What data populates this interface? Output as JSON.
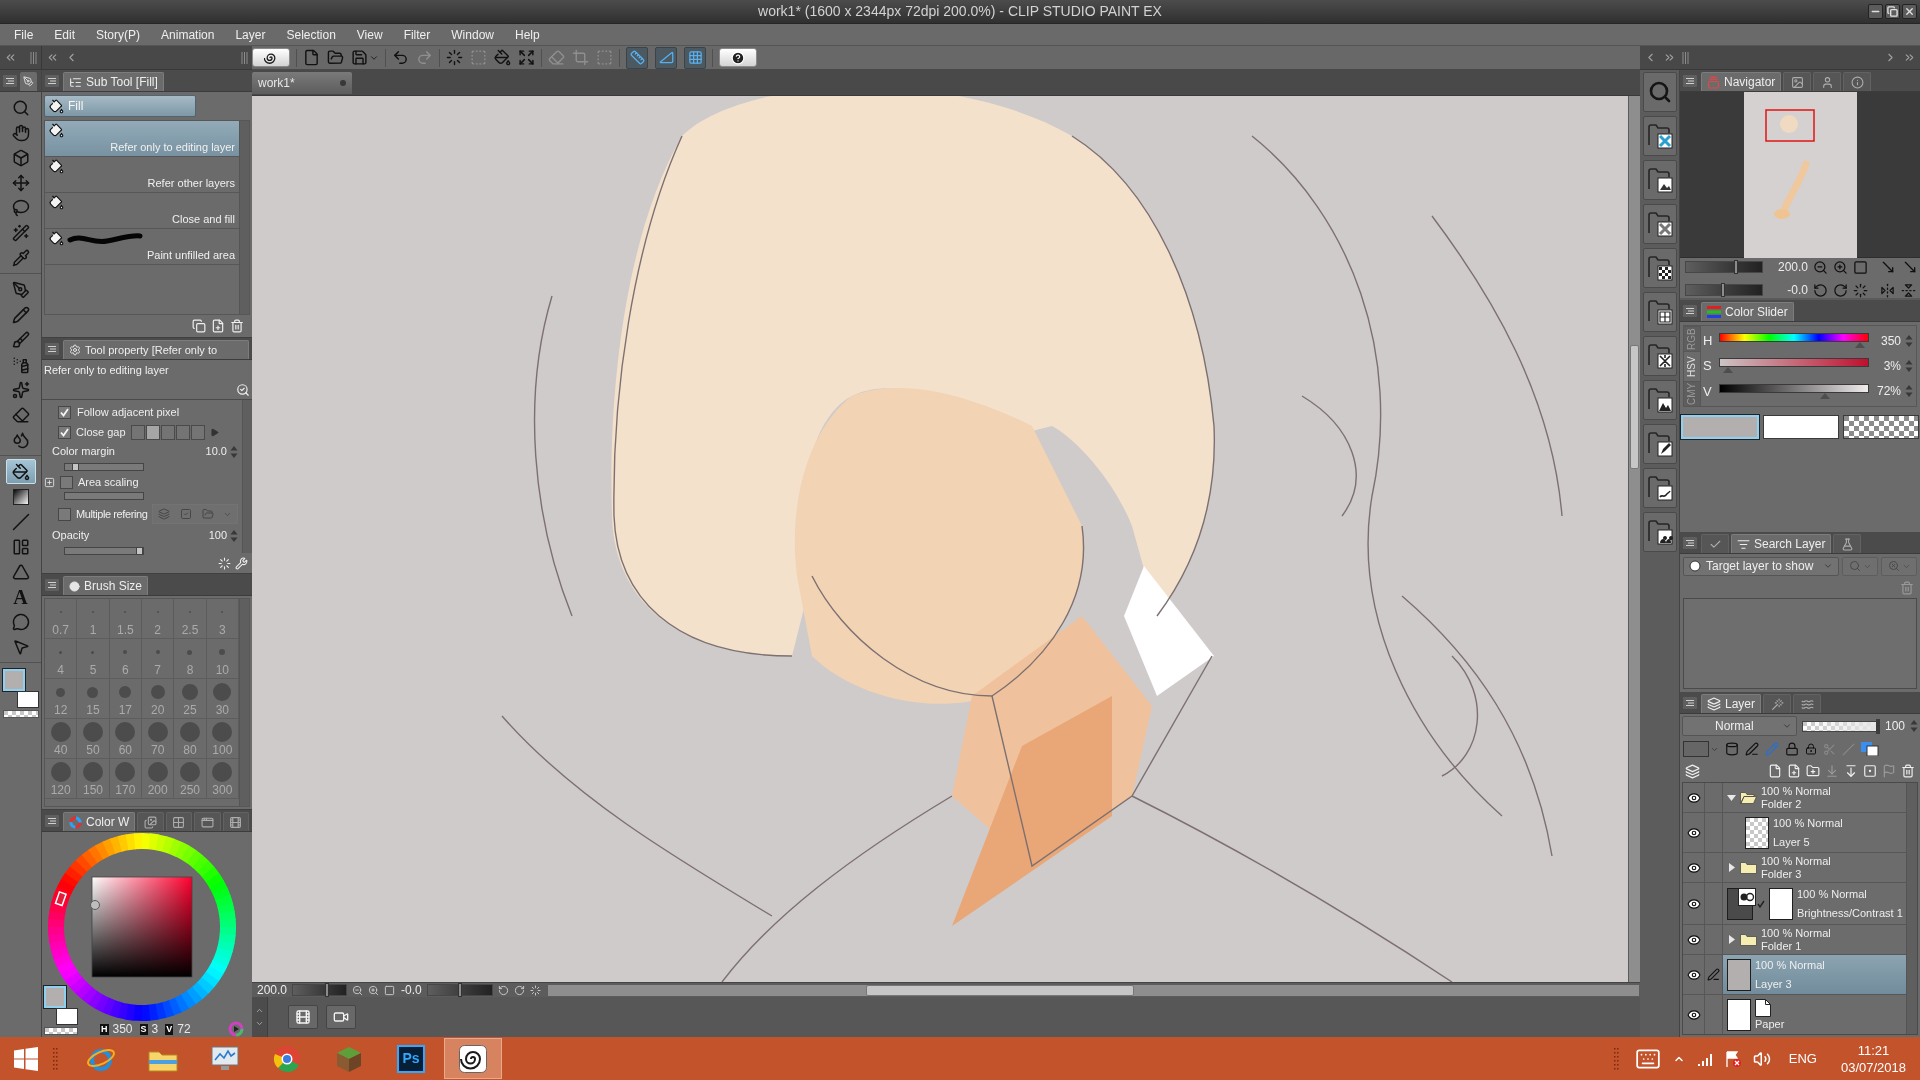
{
  "window": {
    "title": "work1* (1600 x 2344px 72dpi 200.0%) - CLIP STUDIO PAINT EX"
  },
  "menu": [
    "File",
    "Edit",
    "Story(P)",
    "Animation",
    "Layer",
    "Selection",
    "View",
    "Filter",
    "Window",
    "Help"
  ],
  "toolbar": {
    "groups": [
      {
        "buttons": [
          {
            "kind": "logo",
            "disabled": false
          }
        ]
      },
      {
        "buttons": [
          {
            "kind": "new",
            "disabled": false
          },
          {
            "kind": "open",
            "disabled": false
          },
          {
            "kind": "save",
            "disabled": false
          }
        ]
      },
      {
        "buttons": [
          {
            "kind": "undo",
            "disabled": false
          },
          {
            "kind": "redo",
            "disabled": true
          }
        ]
      },
      {
        "buttons": [
          {
            "kind": "dots",
            "disabled": false
          },
          {
            "kind": "box",
            "disabled": true
          },
          {
            "kind": "fill",
            "disabled": false
          },
          {
            "kind": "transform",
            "disabled": false
          }
        ]
      },
      {
        "buttons": [
          {
            "kind": "clear",
            "disabled": true
          },
          {
            "kind": "trim",
            "disabled": true
          },
          {
            "kind": "frame",
            "disabled": true
          }
        ]
      },
      {
        "buttons": [
          {
            "kind": "snap_ruler",
            "on": true
          },
          {
            "kind": "snap_special",
            "on": true
          },
          {
            "kind": "snap_grid",
            "on": true
          }
        ]
      },
      {
        "buttons": [
          {
            "kind": "help",
            "disabled": false
          }
        ]
      }
    ]
  },
  "tool_palette": {
    "groups": [
      {
        "tools": [
          {
            "kind": "zoom",
            "selected": false
          },
          {
            "kind": "hand",
            "selected": false
          },
          {
            "kind": "object",
            "selected": false
          },
          {
            "kind": "move",
            "selected": false
          },
          {
            "kind": "lasso",
            "selected": false
          },
          {
            "kind": "wand",
            "selected": false
          },
          {
            "kind": "eyedropper",
            "selected": false
          }
        ]
      },
      {
        "tools": [
          {
            "kind": "pen",
            "selected": false
          },
          {
            "kind": "pencil",
            "selected": false
          },
          {
            "kind": "brush",
            "selected": false
          },
          {
            "kind": "airbrush",
            "selected": false
          },
          {
            "kind": "decoration",
            "selected": false
          },
          {
            "kind": "eraser",
            "selected": false
          },
          {
            "kind": "blend",
            "selected": false
          }
        ]
      },
      {
        "tools": [
          {
            "kind": "fill",
            "selected": true
          },
          {
            "kind": "gradient",
            "selected": false
          },
          {
            "kind": "line",
            "selected": false
          },
          {
            "kind": "frame",
            "selected": false
          },
          {
            "kind": "ruler",
            "selected": false
          },
          {
            "kind": "text",
            "glyph": "A",
            "selected": false
          },
          {
            "kind": "balloon",
            "selected": false
          },
          {
            "kind": "correct",
            "selected": false
          }
        ]
      }
    ]
  },
  "drawing_colors": [
    {
      "kind": "main",
      "color": "#b3afae",
      "selected": true
    },
    {
      "kind": "sub",
      "color": "#ffffff",
      "selected": false
    },
    {
      "kind": "transparent",
      "selected": false
    }
  ],
  "sub_tool": {
    "title": "Sub Tool [Fill]",
    "group": "Fill",
    "items": [
      {
        "kind": "icon",
        "label": "Refer only to editing layer",
        "selected": true
      },
      {
        "kind": "icon",
        "label": "Refer other layers",
        "selected": false
      },
      {
        "kind": "icon",
        "label": "Close and fill",
        "selected": false
      },
      {
        "kind": "stroke",
        "label": "Paint unfilled area",
        "selected": false
      }
    ]
  },
  "tool_property": {
    "title": "Tool property [Refer only to",
    "preview": "Refer only to editing layer",
    "properties": [
      {
        "kind": "check",
        "label": "Follow adjacent pixel",
        "checked": true
      },
      {
        "kind": "gap",
        "label": "Close gap",
        "checked": true,
        "gap_sizes": [
          {
            "selected": false
          },
          {
            "selected": true
          },
          {
            "selected": false
          },
          {
            "selected": false
          },
          {
            "selected": false
          }
        ]
      },
      {
        "kind": "slider",
        "label": "Color margin",
        "value": "10.0",
        "level": 0.1
      },
      {
        "kind": "check_slider",
        "label": "Area scaling",
        "checked": false
      },
      {
        "kind": "check_icons",
        "label": "Multiple refering",
        "checked": false
      },
      {
        "kind": "slider",
        "label": "Opacity",
        "value": "100",
        "level": 1
      }
    ]
  },
  "brush_size": {
    "title": "Brush Size",
    "sizes": [
      "0.7",
      "1",
      "1.5",
      "2",
      "2.5",
      "3",
      "4",
      "5",
      "6",
      "7",
      "8",
      "10",
      "12",
      "15",
      "17",
      "20",
      "25",
      "30",
      "40",
      "50",
      "60",
      "70",
      "80",
      "100",
      "120",
      "150",
      "170",
      "200",
      "250",
      "300"
    ]
  },
  "color_wheel": {
    "tabs": [
      {
        "kind": "label",
        "label": "Color W",
        "selected": true
      },
      {
        "kind": "images",
        "selected": false
      },
      {
        "kind": "grid",
        "selected": false
      },
      {
        "kind": "window",
        "selected": false
      },
      {
        "kind": "film",
        "selected": false
      }
    ],
    "readouts": [
      {
        "label": "H",
        "value": "350"
      },
      {
        "label": "S",
        "value": "3"
      },
      {
        "label": "V",
        "value": "72"
      }
    ]
  },
  "canvas": {
    "tab": "work1*",
    "sliders": [
      {
        "kind": "zoom",
        "value": "200.0",
        "level": 0.66
      },
      {
        "kind": "rotation",
        "value": "-0.0",
        "level": 0.5
      }
    ]
  },
  "navigator": {
    "tabs": [
      {
        "kind": "label",
        "label": "Navigator",
        "selected": true
      },
      {
        "kind": "image",
        "selected": false
      },
      {
        "kind": "person",
        "selected": false
      },
      {
        "kind": "info",
        "selected": false
      }
    ],
    "sliders": [
      {
        "kind": "zoom",
        "value": "200.0",
        "level": 0.66
      },
      {
        "kind": "rotation",
        "value": "-0.0",
        "level": 0.48
      }
    ]
  },
  "color_slider": {
    "title": "Color Slider",
    "modes": [
      {
        "label": "RGB",
        "selected": false
      },
      {
        "label": "HSV",
        "selected": true
      },
      {
        "label": "CMY",
        "selected": false
      }
    ],
    "channels": [
      {
        "kind": "hue",
        "label": "H",
        "value": "350",
        "level": 0.97
      },
      {
        "kind": "saturation",
        "label": "S",
        "value": "3%",
        "level": 0.03
      },
      {
        "kind": "value",
        "label": "V",
        "value": "72%",
        "level": 0.72
      }
    ]
  },
  "search_layer": {
    "tabs": [
      {
        "kind": "check",
        "selected": false
      },
      {
        "kind": "label",
        "label": "Search Layer",
        "selected": true
      },
      {
        "kind": "flask",
        "selected": false
      }
    ],
    "target": "Target layer to show"
  },
  "layer_panel": {
    "tabs": [
      {
        "kind": "label",
        "label": "Layer",
        "selected": true
      },
      {
        "kind": "wand",
        "selected": false
      },
      {
        "kind": "waves",
        "selected": false
      }
    ],
    "blend_mode": "Normal",
    "opacity": "100",
    "level": 1,
    "layers": [
      {
        "kind": "folder",
        "mode": "100 % Normal",
        "name": "Folder 2",
        "visible": true,
        "editing": false,
        "selected": false,
        "expanded": true,
        "children": [
          {
            "kind": "raster",
            "mode": "100 % Normal",
            "name": "Layer 5",
            "visible": true,
            "editing": false,
            "selected": false
          }
        ]
      },
      {
        "kind": "folder",
        "mode": "100 % Normal",
        "name": "Folder 3",
        "visible": true,
        "editing": false,
        "selected": false,
        "expanded": false
      },
      {
        "kind": "correction",
        "mode": "100 % Normal",
        "name": "Brightness/Contrast 1",
        "visible": true,
        "editing": false,
        "selected": false
      },
      {
        "kind": "folder",
        "mode": "100 % Normal",
        "name": "Folder 1",
        "visible": true,
        "editing": false,
        "selected": false,
        "expanded": false
      },
      {
        "kind": "raster",
        "mode": "100 % Normal",
        "name": "Layer 3",
        "visible": true,
        "editing": true,
        "selected": true,
        "color": "#b3afae"
      },
      {
        "kind": "paper",
        "name": "Paper",
        "visible": true,
        "editing": false,
        "selected": false
      }
    ]
  },
  "taskbar": {
    "apps": [
      {
        "kind": "browser",
        "active": false
      },
      {
        "kind": "files",
        "active": false
      },
      {
        "kind": "monitor",
        "active": false
      },
      {
        "kind": "web",
        "active": false
      },
      {
        "kind": "cube",
        "active": false
      },
      {
        "kind": "photo",
        "label": "Ps",
        "active": false
      },
      {
        "kind": "paint",
        "active": true
      }
    ],
    "language": "ENG",
    "time": "11:21",
    "date": "03/07/2018"
  }
}
